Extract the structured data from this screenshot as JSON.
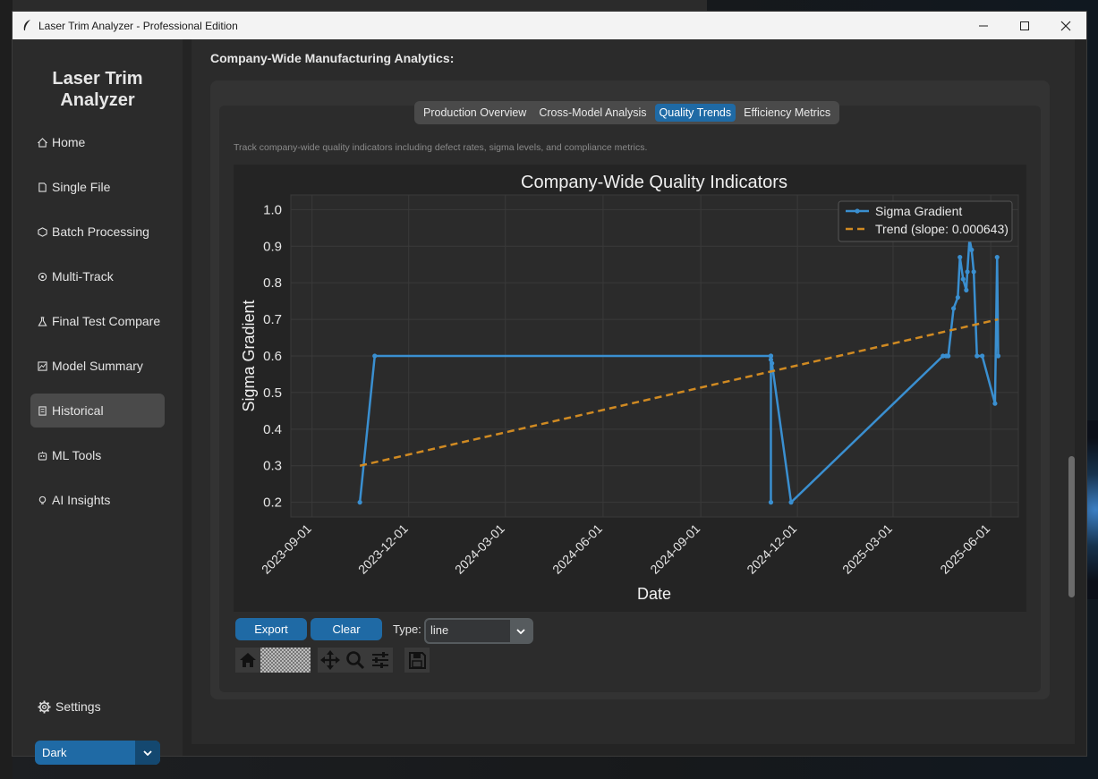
{
  "window": {
    "title": "Laser Trim Analyzer - Professional Edition",
    "controls": [
      "minimize",
      "maximize",
      "close"
    ]
  },
  "sidebar": {
    "heading_line1": "Laser Trim",
    "heading_line2": "Analyzer",
    "items": [
      {
        "label": "Home",
        "icon": "home-icon"
      },
      {
        "label": "Single File",
        "icon": "file-icon"
      },
      {
        "label": "Batch Processing",
        "icon": "package-icon"
      },
      {
        "label": "Multi-Track",
        "icon": "target-icon"
      },
      {
        "label": "Final Test Compare",
        "icon": "flask-icon"
      },
      {
        "label": "Model Summary",
        "icon": "chart-icon"
      },
      {
        "label": "Historical",
        "icon": "history-icon",
        "active": true
      },
      {
        "label": "ML Tools",
        "icon": "robot-icon"
      },
      {
        "label": "AI Insights",
        "icon": "bulb-icon"
      }
    ],
    "settings_label": "Settings",
    "theme_value": "Dark"
  },
  "main": {
    "section_title": "Company-Wide Manufacturing Analytics:",
    "tabs": [
      {
        "label": "Production Overview"
      },
      {
        "label": "Cross-Model Analysis"
      },
      {
        "label": "Quality Trends",
        "active": true
      },
      {
        "label": "Efficiency Metrics"
      }
    ],
    "description": "Track company-wide quality indicators including defect rates, sigma levels, and compliance metrics.",
    "export_label": "Export",
    "clear_label": "Clear",
    "type_label": "Type:",
    "type_value": "line"
  },
  "toolbar": {
    "buttons": [
      "home-icon",
      "back-icon",
      "forward-icon",
      "pan-icon",
      "zoom-icon",
      "configure-icon",
      "save-icon"
    ]
  },
  "chart_data": {
    "type": "line",
    "title": "Company-Wide Quality Indicators",
    "xlabel": "Date",
    "ylabel": "Sigma Gradient",
    "x_ticks": [
      "2023-09-01",
      "2023-12-01",
      "2024-03-01",
      "2024-06-01",
      "2024-09-01",
      "2024-12-01",
      "2025-03-01",
      "2025-06-01"
    ],
    "y_ticks": [
      "0.2",
      "0.3",
      "0.4",
      "0.5",
      "0.6",
      "0.7",
      "0.8",
      "0.9",
      "1.0"
    ],
    "ylim": [
      0.16,
      1.04
    ],
    "xlim": [
      "2023-08-12",
      "2025-06-27"
    ],
    "grid": true,
    "legend_position": "top-right",
    "series": [
      {
        "name": "Sigma Gradient",
        "color": "#3a8fd0",
        "x": [
          "2023-10-16",
          "2023-10-30",
          "2024-11-06",
          "2024-11-06",
          "2024-11-06",
          "2024-11-06",
          "2024-11-07",
          "2024-11-25",
          "2025-04-17",
          "2025-04-20",
          "2025-04-22",
          "2025-04-27",
          "2025-05-01",
          "2025-05-03",
          "2025-05-06",
          "2025-05-09",
          "2025-05-10",
          "2025-05-12",
          "2025-05-14",
          "2025-05-16",
          "2025-05-19",
          "2025-05-24",
          "2025-06-05",
          "2025-06-07",
          "2025-06-08"
        ],
        "y": [
          0.2,
          0.6,
          0.6,
          0.2,
          0.6,
          0.59,
          0.58,
          0.2,
          0.6,
          0.6,
          0.6,
          0.73,
          0.76,
          0.87,
          0.81,
          0.78,
          0.83,
          0.92,
          0.89,
          0.83,
          0.6,
          0.6,
          0.47,
          0.87,
          0.6
        ]
      },
      {
        "name": "Trend (slope: 0.000643)",
        "color": "#d08a22",
        "style": "dashed",
        "x": [
          "2023-10-16",
          "2025-06-08"
        ],
        "y": [
          0.3,
          0.7
        ]
      }
    ]
  }
}
